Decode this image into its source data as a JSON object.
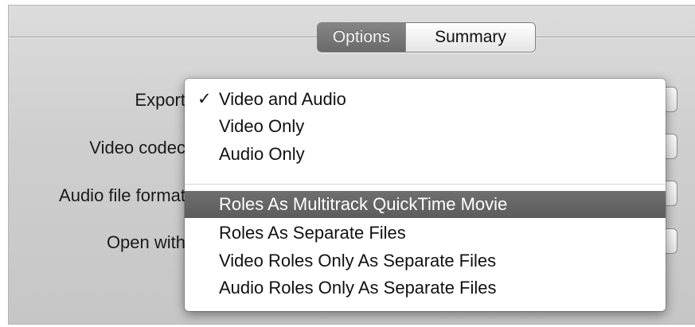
{
  "tabs": [
    {
      "label": "Options",
      "selected": true
    },
    {
      "label": "Summary",
      "selected": false
    }
  ],
  "form": {
    "export_label": "Export",
    "video_codec_label": "Video codec",
    "audio_format_label": "Audio file format",
    "open_with_label": "Open with"
  },
  "menu": {
    "selected_item": "Video and Audio",
    "highlighted_item": "Roles As Multitrack QuickTime Movie",
    "check_glyph": "✓",
    "group1": [
      {
        "label": "Video and Audio"
      },
      {
        "label": "Video Only"
      },
      {
        "label": "Audio Only"
      }
    ],
    "group2": [
      {
        "label": "Roles As Multitrack QuickTime Movie"
      },
      {
        "label": "Roles As Separate Files"
      },
      {
        "label": "Video Roles Only As Separate Files"
      },
      {
        "label": "Audio Roles Only As Separate Files"
      }
    ]
  },
  "colors": {
    "highlight": "#666666",
    "panel_background": "#cfcfcf",
    "selected_tab": "#777777"
  }
}
